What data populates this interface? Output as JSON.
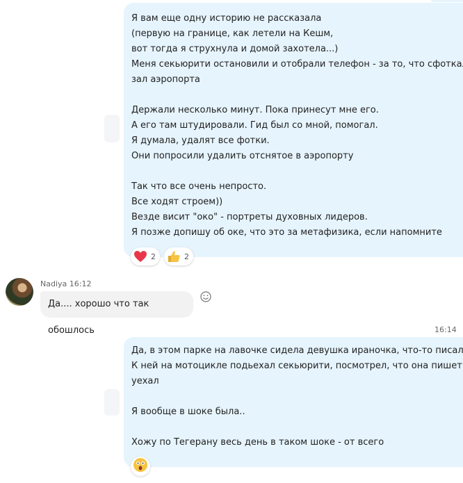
{
  "messages": [
    {
      "id": "msg1",
      "lines": [
        "Я вам еще одну историю не рассказала",
        "(первую на границе, как летели на Кешм,",
        "вот тогда я струхнула и домой захотела...)",
        "Меня секьюрити остановили и отобрали телефон - за то, что сфоткала",
        "зал аэропорта",
        "",
        "Держали несколько минут. Пока принесут мне его.",
        "А его там штудировали. Гид был со мной, помогал.",
        "Я думала, удалят все фотки.",
        "Они попросили удалить отснятое в аэропорту",
        "",
        "Так что все очень непросто.",
        "Все ходят строем))",
        "Везде висит \"око\" - портреты духовных лидеров.",
        "Я позже допишу об оке, что это за метафизика, если напомните"
      ],
      "reactions": [
        {
          "icon": "heart-icon",
          "count": "2"
        },
        {
          "icon": "thumbs-up-icon",
          "count": "2"
        }
      ]
    },
    {
      "id": "msg2",
      "sender": "Nadiya 16:12",
      "text": "Да.... хорошо что так обошлось"
    },
    {
      "id": "msg3",
      "timestamp": "16:14",
      "lines": [
        "Да, в этом парке на лавочке сидела девушка ираночка, что-то писала.",
        "К ней на мотоцикле подьехал секьюрити, посмотрел, что она пишет - и",
        "уехал",
        "",
        "Я вообще в шоке была..",
        "",
        "Хожу по Тегерану весь день в таком шоке - от всего"
      ],
      "reaction_icon": "shocked-face-icon"
    }
  ],
  "colors": {
    "outgoing_bubble": "#e6f4fd",
    "incoming_bubble": "#f2f2f2",
    "heart": "#e8374a",
    "thumb": "#f6c343"
  }
}
